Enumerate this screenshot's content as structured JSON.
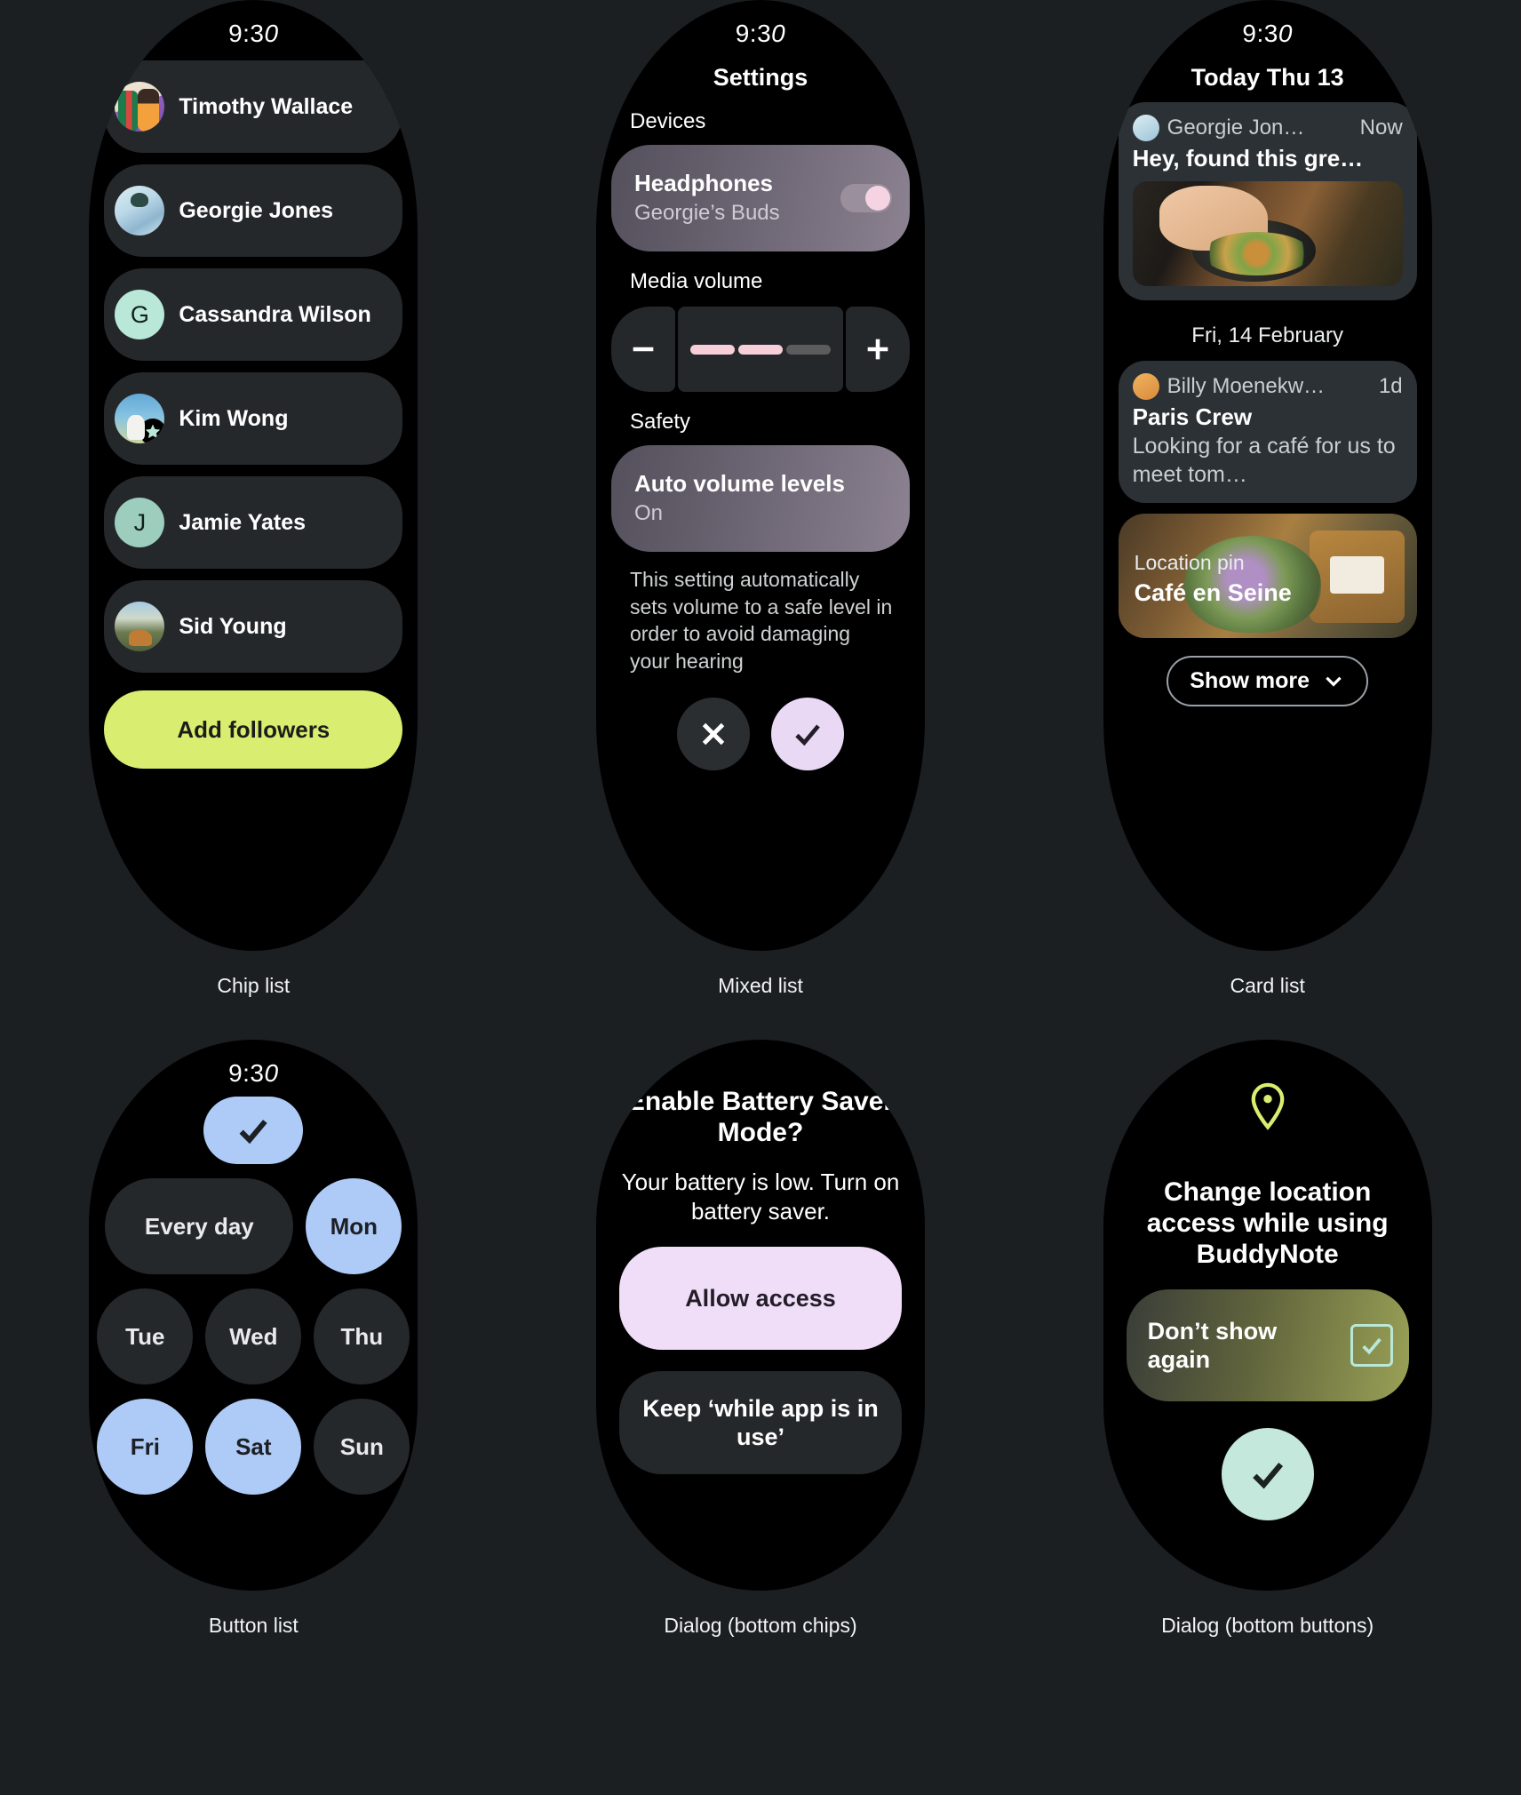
{
  "panels": [
    {
      "caption": "Chip list",
      "time": "9:30",
      "items": [
        {
          "name": "Timothy Wallace",
          "avatar": "photo-couple-avatar"
        },
        {
          "name": "Georgie Jones",
          "avatar": "photo-person-avatar"
        },
        {
          "name": "Cassandra Wilson",
          "avatar": "initial-avatar",
          "initial": "G"
        },
        {
          "name": "Kim Wong",
          "avatar": "photo-field-avatar",
          "badge": "star-badge"
        },
        {
          "name": "Jamie Yates",
          "avatar": "initial-avatar",
          "initial": "J"
        },
        {
          "name": "Sid Young",
          "avatar": "photo-landscape-avatar"
        }
      ],
      "add_button": "Add followers"
    },
    {
      "caption": "Mixed list",
      "time": "9:30",
      "title": "Settings",
      "devices_label": "Devices",
      "headphones": {
        "title": "Headphones",
        "subtitle": "Georgie’s Buds",
        "toggle": "on"
      },
      "media_volume_label": "Media volume",
      "volume": {
        "segments": 3,
        "filled": 2,
        "minus": "minus-icon",
        "plus": "plus-icon"
      },
      "safety_label": "Safety",
      "auto_volume": {
        "title": "Auto volume levels",
        "value": "On"
      },
      "description": "This setting automatically sets volume to a safe level in order to avoid damaging your hearing",
      "actions": [
        {
          "name": "dismiss-button",
          "icon": "close-icon"
        },
        {
          "name": "confirm-button",
          "icon": "check-icon"
        }
      ]
    },
    {
      "caption": "Card list",
      "time": "9:30",
      "title": "Today Thu 13",
      "card1": {
        "sender": "Georgie Jon…",
        "time": "Now",
        "message": "Hey, found this gre…",
        "image": "cooking-herbs-photo"
      },
      "date_divider": "Fri, 14 February",
      "card2": {
        "sender": "Billy Moenekw…",
        "time": "1d",
        "title": "Paris Crew",
        "message": "Looking for a café for us to meet tom…"
      },
      "card3": {
        "label": "Location pin",
        "title": "Café en Seine",
        "image": "cafe-table-flowers-photo"
      },
      "show_more": {
        "label": "Show more",
        "icon": "chevron-down-icon"
      }
    },
    {
      "caption": "Button list",
      "time": "9:30",
      "confirm": {
        "icon": "check-icon"
      },
      "every_day": "Every day",
      "days": [
        {
          "label": "Mon",
          "selected": true
        },
        {
          "label": "Tue",
          "selected": false
        },
        {
          "label": "Wed",
          "selected": false
        },
        {
          "label": "Thu",
          "selected": false
        },
        {
          "label": "Fri",
          "selected": true
        },
        {
          "label": "Sat",
          "selected": true
        },
        {
          "label": "Sun",
          "selected": false
        }
      ]
    },
    {
      "caption": "Dialog (bottom chips)",
      "title": "Enable Battery Saver Mode?",
      "body": "Your battery is low. Turn on battery saver.",
      "primary_button": "Allow access",
      "secondary_button": "Keep ‘while app is in use’"
    },
    {
      "caption": "Dialog (bottom buttons)",
      "icon": "location-pin-icon",
      "title": "Change location access while using BuddyNote",
      "checkbox_label": "Don’t show again",
      "checkbox_state": "checked",
      "confirm": {
        "icon": "check-icon"
      }
    }
  ],
  "colors": {
    "page_bg": "#1b1f22",
    "watch_bg": "#000000",
    "chip_bg": "#25282b",
    "accent_lime": "#d9ed70",
    "accent_blue": "#aecbf7",
    "accent_lilac": "#e9d9f5",
    "accent_mint": "#c5e8dc",
    "accent_pink": "#f7cfd9"
  }
}
